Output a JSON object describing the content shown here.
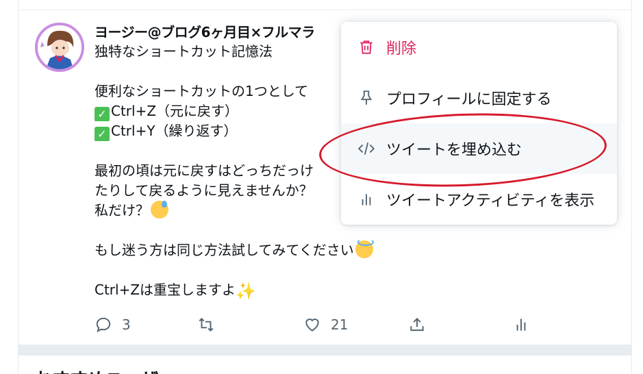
{
  "tweet": {
    "author_line": "ヨージー@ブログ6ヶ月目×フルマラ",
    "lines": [
      {
        "text": "独特なショートカット記憶法"
      },
      {
        "gap": true
      },
      {
        "text": "便利なショートカットの1つとして"
      },
      {
        "check": true,
        "text": "Ctrl+Z（元に戻す）"
      },
      {
        "check": true,
        "text": "Ctrl+Y（繰り返す）"
      },
      {
        "gap": true
      },
      {
        "text": "最初の頃は元に戻すはどっちだっけ"
      },
      {
        "text": "たりして戻るように見えませんか？"
      },
      {
        "text": "私だけ？",
        "emoji": "sweat"
      },
      {
        "gap": true
      },
      {
        "text": "もし迷う方は同じ方法試してみてください",
        "emoji": "halo"
      },
      {
        "gap": true
      },
      {
        "text": "Ctrl+Zは重宝しますよ",
        "sparkle": true
      }
    ],
    "check_glyph": "✓",
    "sparkle_glyph": "✨",
    "reply_count": "3",
    "like_count": "21"
  },
  "menu": {
    "items": [
      {
        "label": "削除",
        "icon": "trash-icon",
        "danger": true
      },
      {
        "label": "プロフィールに固定する",
        "icon": "pin-icon"
      },
      {
        "label": "ツイートを埋め込む",
        "icon": "code-icon",
        "hovered": true
      },
      {
        "label": "ツイートアクティビティを表示",
        "icon": "analytics-icon"
      }
    ]
  },
  "next_section": {
    "title": "おすすめユーザー"
  },
  "colors": {
    "accent_danger": "#e0245e",
    "annotation": "#d61a2b",
    "icon_gray": "#536471"
  }
}
